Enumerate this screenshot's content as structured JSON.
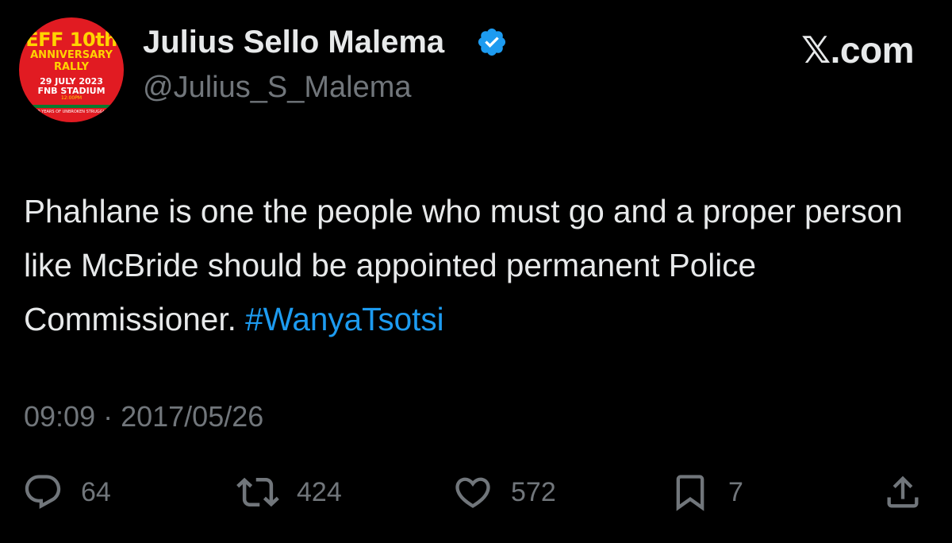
{
  "avatar": {
    "line1": "EFF 10th",
    "line2": "ANNIVERSARY",
    "line3": "RALLY",
    "line4": "29 JULY 2023",
    "line5": "FNB STADIUM",
    "line6": "12:00PM",
    "line7": "10 YEARS OF UNBROKEN STRUGGLE"
  },
  "author": {
    "display_name": "Julius Sello Malema",
    "handle": "@Julius_S_Malema",
    "verified": true
  },
  "brand": "𝕏.com",
  "tweet": {
    "text": "Phahlane is one the people who must go and a proper person like McBride should be appointed permanent Police Commissioner. ",
    "hashtag": "#WanyaTsotsi",
    "timestamp": "09:09 · 2017/05/26"
  },
  "actions": {
    "replies": "64",
    "retweets": "424",
    "likes": "572",
    "bookmarks": "7"
  },
  "colors": {
    "background": "#000000",
    "text": "#e7e9ea",
    "muted": "#71767b",
    "link": "#1d9bf0",
    "verified": "#1d9bf0",
    "avatar_red": "#e11b22"
  },
  "icons": {
    "reply": "reply-icon",
    "retweet": "retweet-icon",
    "like": "heart-icon",
    "bookmark": "bookmark-icon",
    "share": "share-icon",
    "verified": "verified-badge-icon"
  }
}
